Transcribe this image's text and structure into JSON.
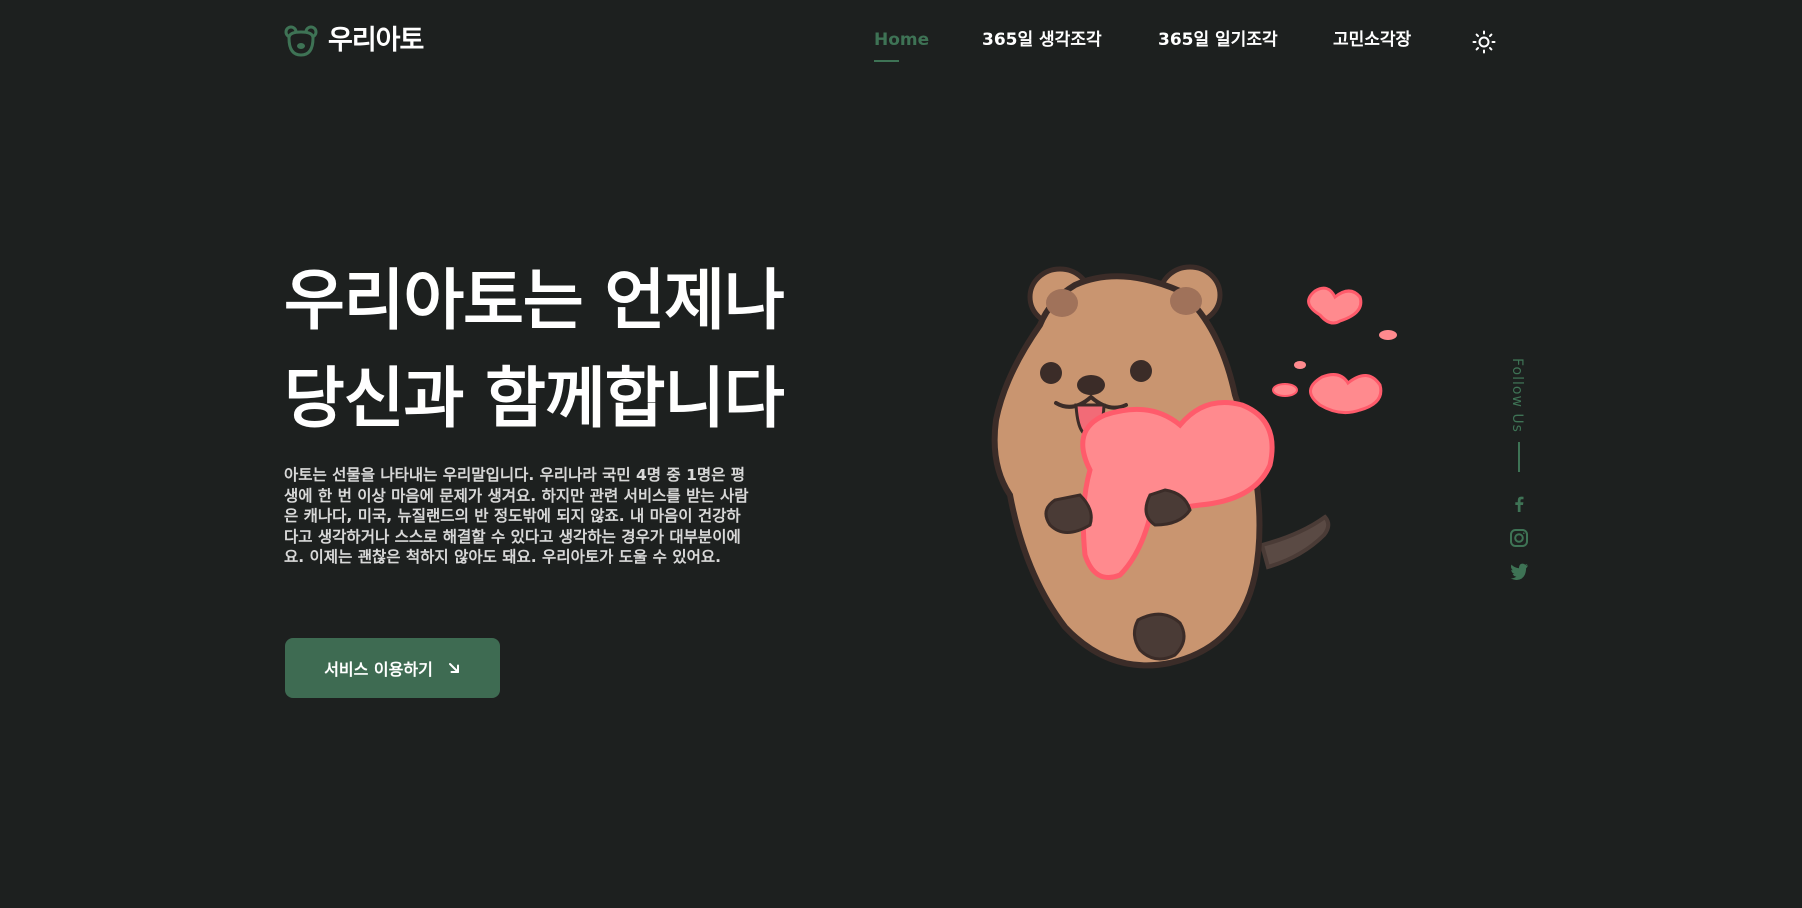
{
  "brand": {
    "name": "우리아토",
    "icon": "bear-face-icon"
  },
  "nav": {
    "items": [
      {
        "label": "Home",
        "active": true
      },
      {
        "label": "365일 생각조각",
        "active": false
      },
      {
        "label": "365일 일기조각",
        "active": false
      },
      {
        "label": "고민소각장",
        "active": false
      }
    ],
    "theme_icon": "sun-icon"
  },
  "hero": {
    "title_line1": "우리아토는 언제나",
    "title_line2": "당신과 함께합니다",
    "description": "아토는 선물을 나타내는 우리말입니다. 우리나라 국민 4명 중 1명은 평생에 한 번 이상 마음에 문제가 생겨요. 하지만 관련 서비스를 받는 사람은 캐나다, 미국, 뉴질랜드의 반 정도밖에 되지 않죠. 내 마음이 건강하다고 생각하거나 스스로 해결할 수 있다고 생각하는 경우가 대부분이에요. 이제는 괜찮은 척하지 않아도 돼요. 우리아토가 도울 수 있어요.",
    "cta_label": "서비스 이용하기",
    "cta_icon": "arrow-down-right-icon",
    "illustration": "quokka-holding-heart"
  },
  "follow": {
    "label": "Follow Us",
    "icons": [
      "facebook-icon",
      "instagram-icon",
      "twitter-icon"
    ]
  },
  "colors": {
    "background": "#1d201f",
    "accent": "#3e7355",
    "button": "#3e6b52",
    "text": "#ffffff"
  }
}
